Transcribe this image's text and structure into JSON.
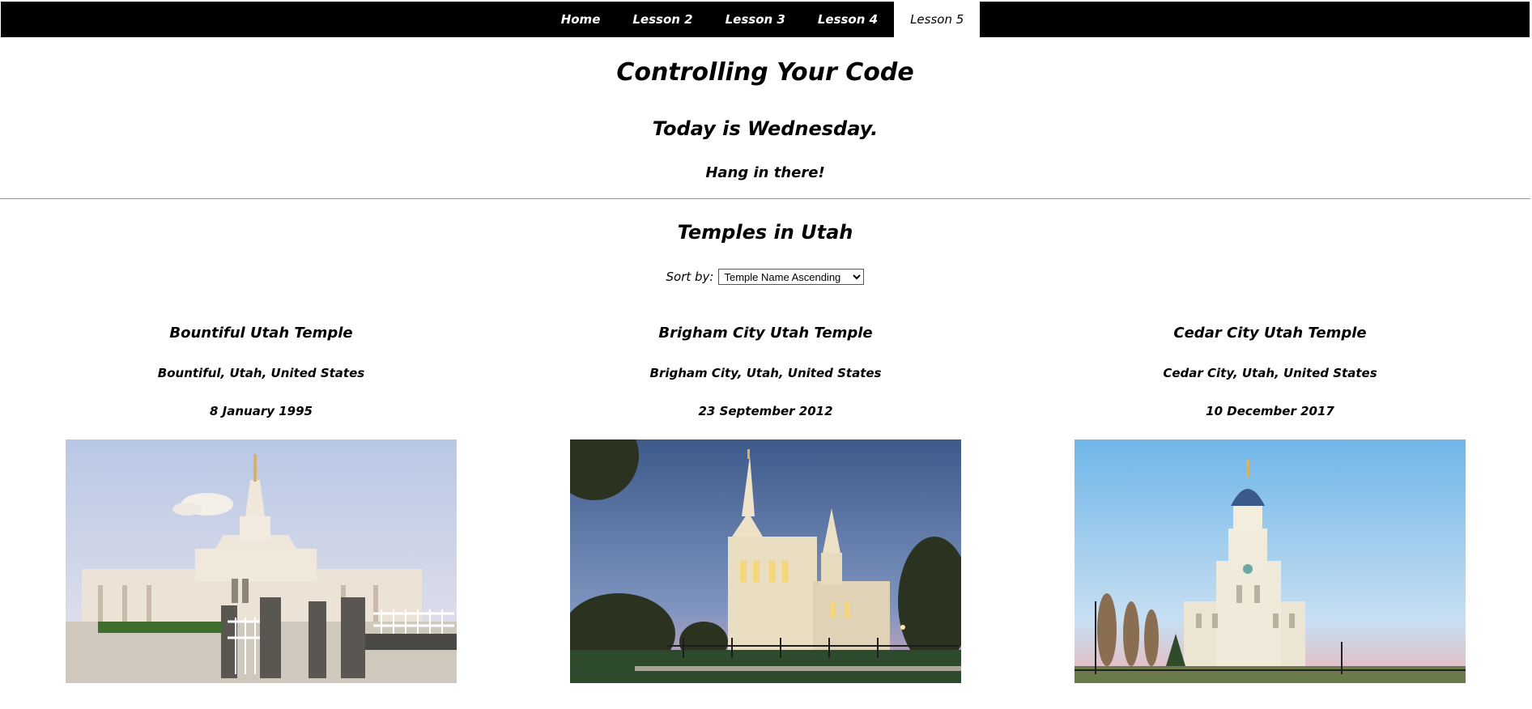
{
  "nav": {
    "items": [
      {
        "label": "Home"
      },
      {
        "label": "Lesson 2"
      },
      {
        "label": "Lesson 3"
      },
      {
        "label": "Lesson 4"
      },
      {
        "label": "Lesson 5"
      }
    ],
    "active": "Lesson 5"
  },
  "header": {
    "title": "Controlling Your Code",
    "today": "Today is Wednesday.",
    "message": "Hang in there!"
  },
  "temples": {
    "heading": "Temples in Utah",
    "sort_label": "Sort by:",
    "sort_selected": "Temple Name Ascending",
    "cards": [
      {
        "name": "Bountiful Utah Temple",
        "location": "Bountiful, Utah, United States",
        "dedicated": "8 January 1995"
      },
      {
        "name": "Brigham City Utah Temple",
        "location": "Brigham City, Utah, United States",
        "dedicated": "23 September 2012"
      },
      {
        "name": "Cedar City Utah Temple",
        "location": "Cedar City, Utah, United States",
        "dedicated": "10 December 2017"
      }
    ]
  }
}
